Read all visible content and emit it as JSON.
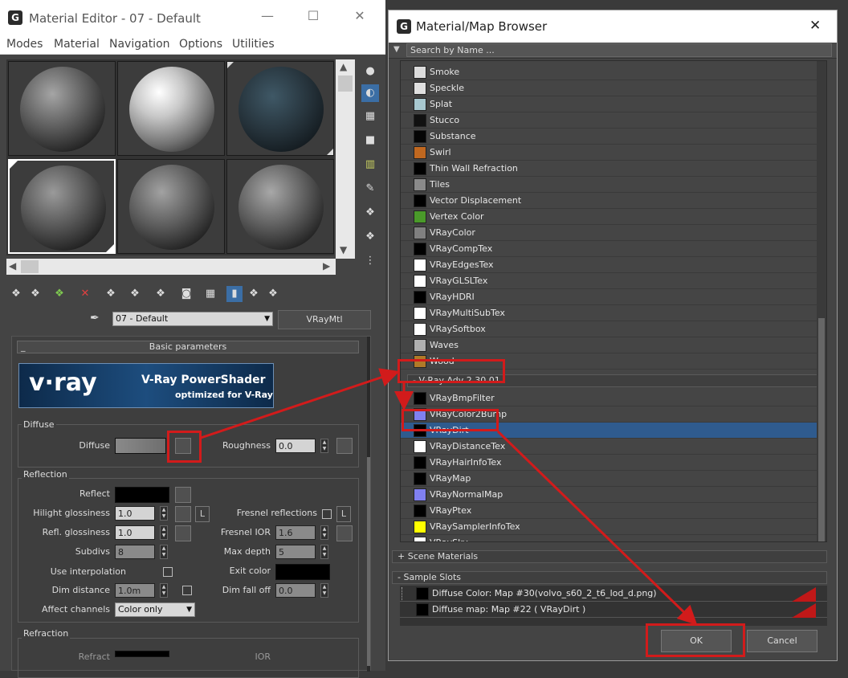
{
  "colors": {
    "accent": "#d21b1b",
    "selection": "#2f5b8e"
  },
  "editor": {
    "title": "Material Editor - 07 - Default",
    "menu": [
      "Modes",
      "Material",
      "Navigation",
      "Options",
      "Utilities"
    ],
    "material_name": "07 - Default",
    "material_type": "VRayMtl",
    "rollout": "Basic parameters",
    "banner": {
      "logo": "v·ray",
      "headline": "V-Ray PowerShader",
      "sub": "optimized for V-Ray"
    },
    "diffuse": {
      "group": "Diffuse",
      "label": "Diffuse",
      "roughness_label": "Roughness",
      "roughness": "0.0"
    },
    "reflection": {
      "group": "Reflection",
      "reflect": "Reflect",
      "hilight": "Hilight glossiness",
      "hilight_val": "1.0",
      "hilight_lock": "L",
      "fresnel": "Fresnel reflections",
      "fresnel_lock": "L",
      "refl_gloss": "Refl. glossiness",
      "refl_gloss_val": "1.0",
      "fresnel_ior": "Fresnel IOR",
      "fresnel_ior_val": "1.6",
      "subdivs": "Subdivs",
      "subdivs_val": "8",
      "max_depth": "Max depth",
      "max_depth_val": "5",
      "use_interp": "Use interpolation",
      "exit_color": "Exit color",
      "dim_dist": "Dim distance",
      "dim_dist_val": "1.0m",
      "dim_falloff": "Dim fall off",
      "dim_falloff_val": "0.0",
      "affect": "Affect channels",
      "affect_val": "Color only"
    },
    "refraction": {
      "group": "Refraction",
      "refract": "Refract",
      "ior": "IOR"
    }
  },
  "browser": {
    "title": "Material/Map Browser",
    "search_placeholder": "Search by Name ...",
    "maps": [
      {
        "name": "Smoke",
        "icon": "#dcdcdc"
      },
      {
        "name": "Speckle",
        "icon": "#e0e0e0"
      },
      {
        "name": "Splat",
        "icon": "#a8c8d0"
      },
      {
        "name": "Stucco",
        "icon": "#111111"
      },
      {
        "name": "Substance",
        "icon": "#050505"
      },
      {
        "name": "Swirl",
        "icon": "#c06820"
      },
      {
        "name": "Thin Wall Refraction",
        "icon": "#000000"
      },
      {
        "name": "Tiles",
        "icon": "#8a8a8a"
      },
      {
        "name": "Vector Displacement",
        "icon": "#000000"
      },
      {
        "name": "Vertex Color",
        "icon": "#4a9a2a"
      },
      {
        "name": "VRayColor",
        "icon": "#808080"
      },
      {
        "name": "VRayCompTex",
        "icon": "#000000"
      },
      {
        "name": "VRayEdgesTex",
        "icon": "#ffffff"
      },
      {
        "name": "VRayGLSLTex",
        "icon": "#ffffff"
      },
      {
        "name": "VRayHDRI",
        "icon": "#000000"
      },
      {
        "name": "VRayMultiSubTex",
        "icon": "#ffffff"
      },
      {
        "name": "VRaySoftbox",
        "icon": "#ffffff"
      },
      {
        "name": "Waves",
        "icon": "#b0b0b0"
      },
      {
        "name": "Wood",
        "icon": "#b07a28"
      }
    ],
    "group_vray": "- V-Ray Adv 2.30.01",
    "vray_maps": [
      {
        "name": "VRayBmpFilter",
        "icon": "#000000"
      },
      {
        "name": "VRayColor2Bump",
        "icon": "#8080f0"
      },
      {
        "name": "VRayDirt",
        "icon": "#000000"
      },
      {
        "name": "VRayDistanceTex",
        "icon": "#ffffff"
      },
      {
        "name": "VRayHairInfoTex",
        "icon": "#000000"
      },
      {
        "name": "VRayMap",
        "icon": "#000000"
      },
      {
        "name": "VRayNormalMap",
        "icon": "#8080f0"
      },
      {
        "name": "VRayPtex",
        "icon": "#000000"
      },
      {
        "name": "VRaySamplerInfoTex",
        "icon": "#ffff00"
      },
      {
        "name": "VRaySky",
        "icon": "#ffffff"
      }
    ],
    "scene_materials": "+ Scene Materials",
    "sample_slots": "- Sample Slots",
    "slots": [
      "Diffuse Color: Map #30(volvo_s60_2_t6_lod_d.png)",
      "Diffuse map: Map #22  ( VRayDirt )"
    ],
    "ok": "OK",
    "cancel": "Cancel"
  }
}
